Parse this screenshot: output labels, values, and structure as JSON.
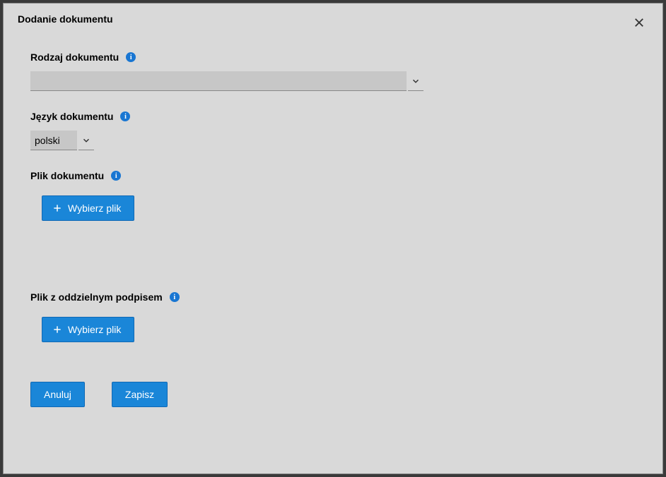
{
  "modal": {
    "title": "Dodanie dokumentu"
  },
  "form": {
    "document_type": {
      "label": "Rodzaj dokumentu",
      "value": ""
    },
    "document_language": {
      "label": "Język dokumentu",
      "value": "polski"
    },
    "document_file": {
      "label": "Plik dokumentu",
      "button": "Wybierz plik"
    },
    "signature_file": {
      "label": "Plik z oddzielnym podpisem",
      "button": "Wybierz plik"
    }
  },
  "actions": {
    "cancel": "Anuluj",
    "save": "Zapisz"
  }
}
